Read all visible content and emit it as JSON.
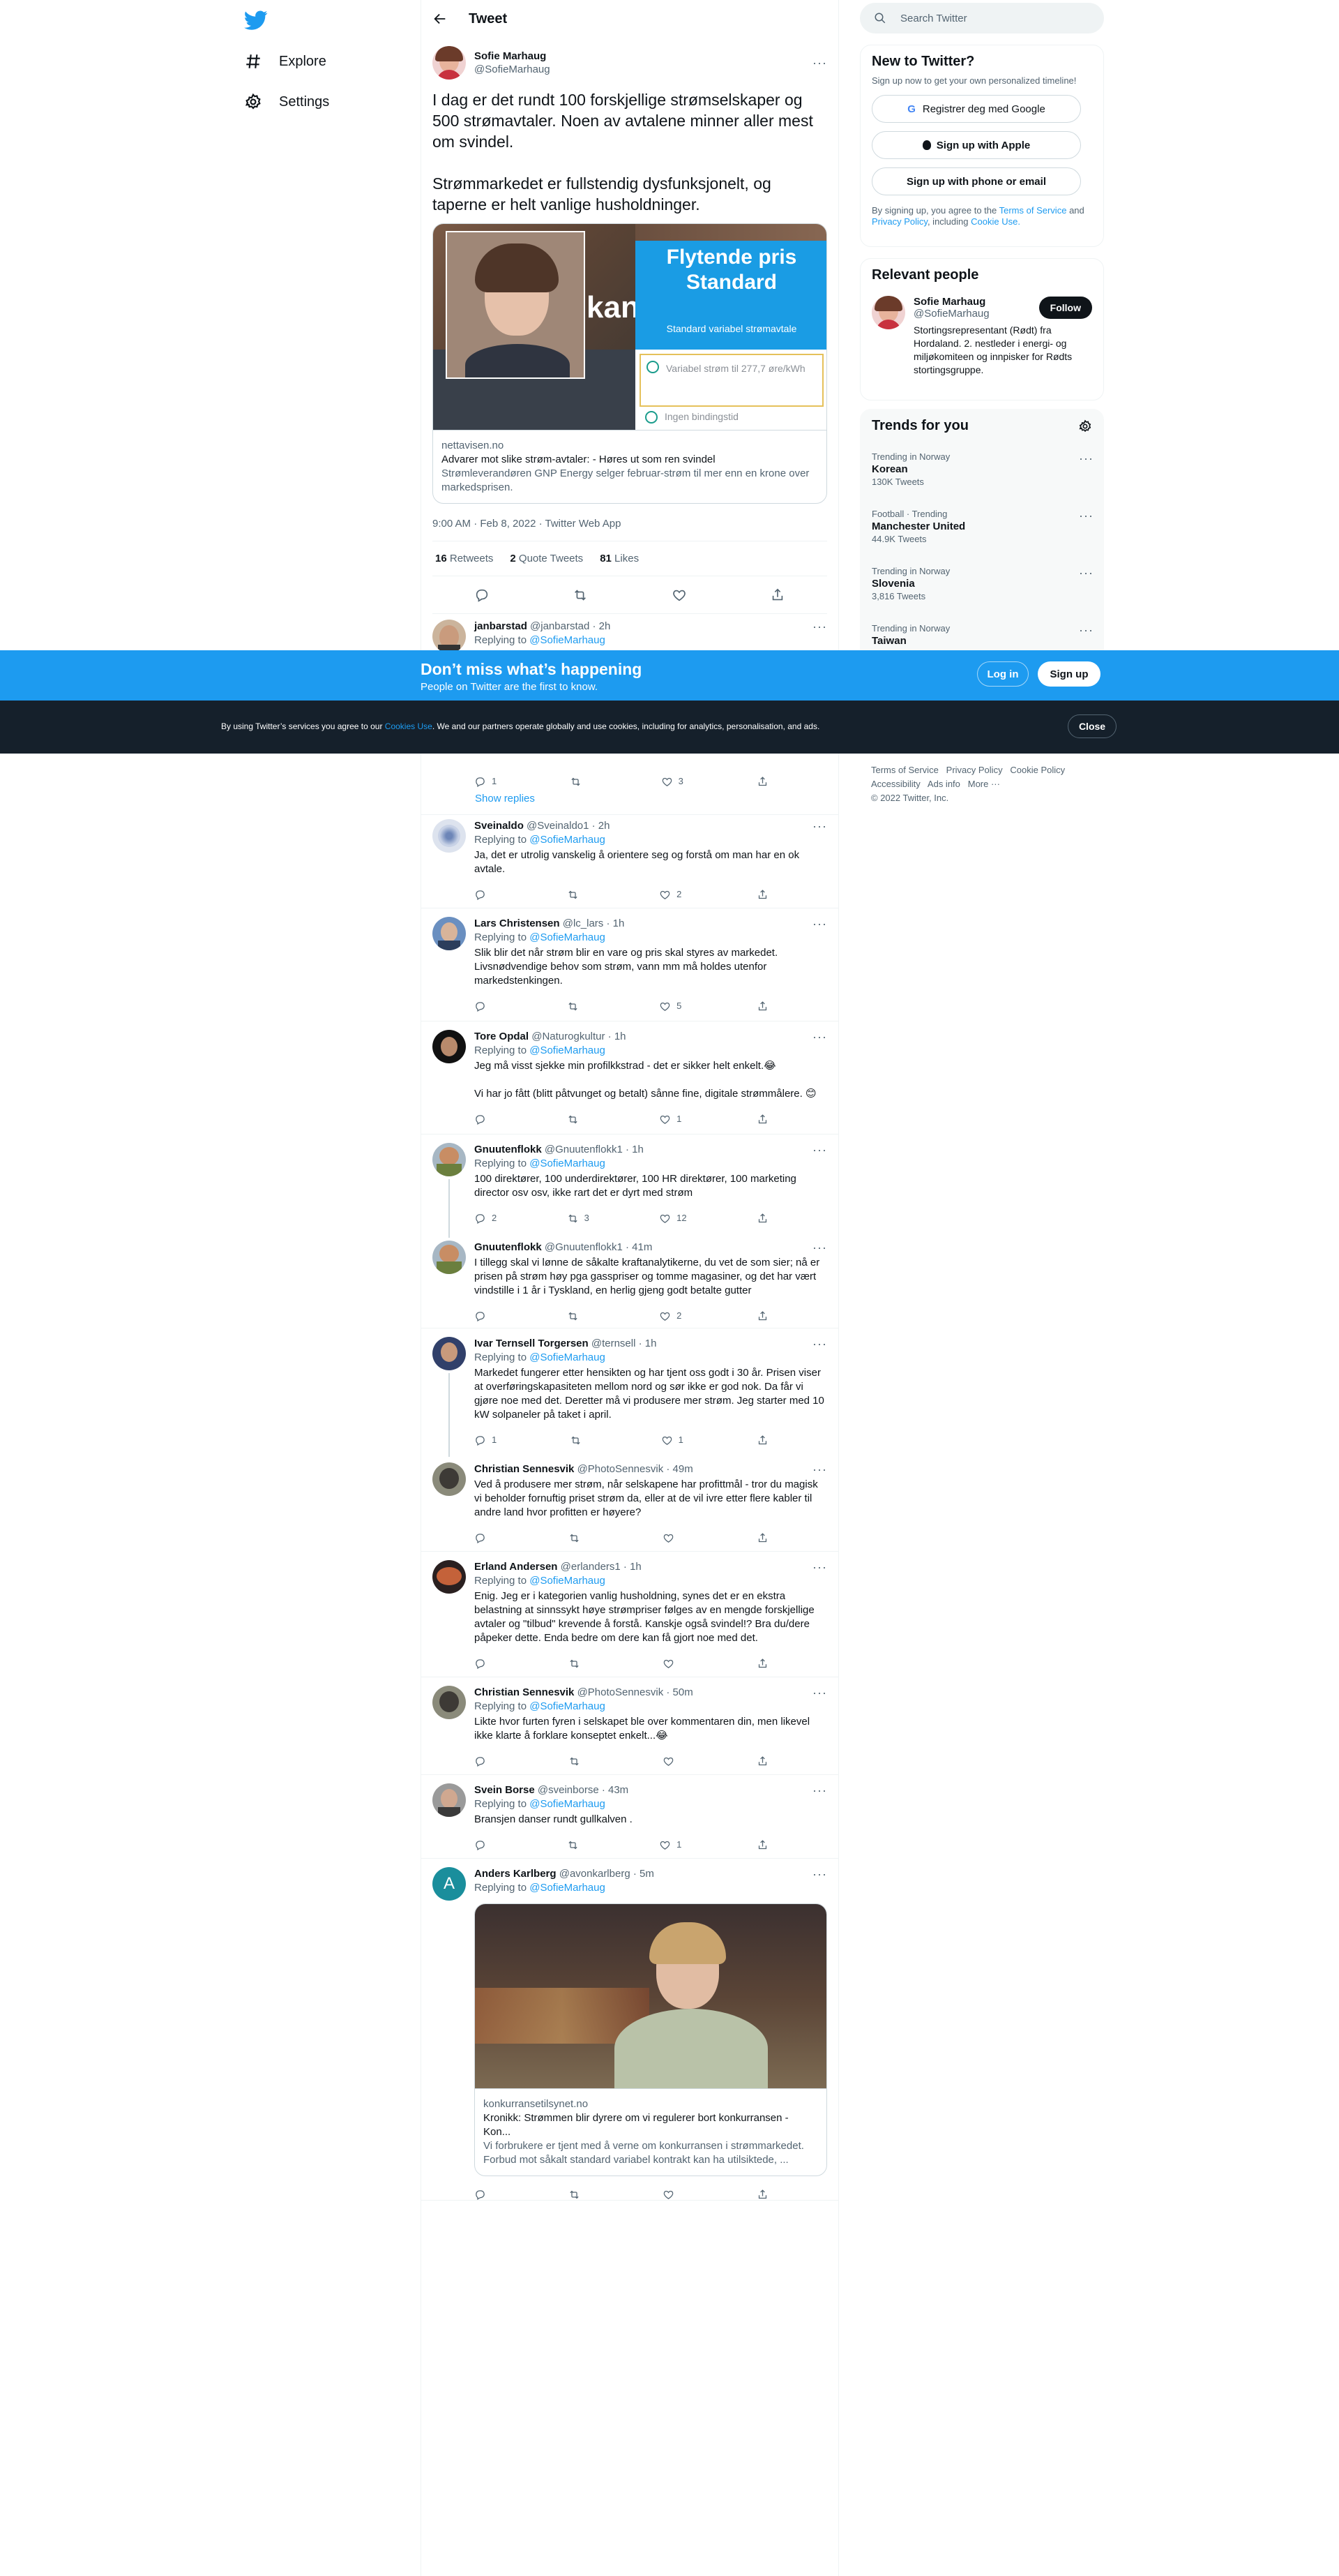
{
  "nav": {
    "explore": "Explore",
    "settings": "Settings"
  },
  "header": {
    "title": "Tweet"
  },
  "main_tweet": {
    "name": "Sofie Marhaug",
    "handle": "@SofieMarhaug",
    "text": "I dag er det rundt 100 forskjellige strømselskaper og 500 strømavtaler. Noen av avtalene minner aller mest om svindel.\n\nStrømmarkedet er fullstendig dysfunksjonelt, og taperne er helt vanlige husholdninger.",
    "card": {
      "img_title": "Flytende pris\nStandard",
      "img_sub": "Standard variabel strømavtale",
      "img_item1": "Variabel strøm til 277,7 øre/kWh",
      "img_item2": "Ingen bindingstid",
      "img_partial": "kan",
      "domain": "nettavisen.no",
      "title": "Advarer mot slike strøm-avtaler: - Høres ut som ren svindel",
      "desc": "Strømleverandøren GNP Energy selger februar-strøm til mer enn en krone over markedsprisen."
    },
    "time": "9:00 AM · Feb 8, 2022 · Twitter Web App",
    "retweets": "16",
    "retweets_label": "Retweets",
    "quotes": "2",
    "quotes_label": "Quote Tweets",
    "likes": "81",
    "likes_label": "Likes"
  },
  "replies": [
    {
      "name": "janbarstad",
      "handle": "@janbarstad · 2h",
      "replying": "Replying to",
      "to": "@SofieMarhaug",
      "text": "",
      "reply": "1",
      "rt": "",
      "like": "3"
    },
    {
      "show_replies": "Show replies"
    },
    {
      "name": "Sveinaldo",
      "handle": "@Sveinaldo1 · 2h",
      "replying": "Replying to",
      "to": "@SofieMarhaug",
      "text": "Ja, det er utrolig vanskelig å orientere seg og forstå om man har en ok avtale.",
      "reply": "",
      "rt": "",
      "like": "2"
    },
    {
      "name": "Lars Christensen",
      "handle": "@lc_lars · 1h",
      "replying": "Replying to",
      "to": "@SofieMarhaug",
      "text": "Slik blir det når strøm blir en vare og pris skal styres av markedet. Livsnødvendige behov som strøm, vann mm må holdes utenfor markedstenkingen.",
      "reply": "",
      "rt": "",
      "like": "5"
    },
    {
      "name": "Tore Opdal",
      "handle": "@Naturogkultur · 1h",
      "replying": "Replying to",
      "to": "@SofieMarhaug",
      "text": "Jeg må visst sjekke min profilkkstrad - det er sikker helt enkelt.😂\n\nVi har jo fått (blitt påtvunget og betalt) sånne fine, digitale strømmålere. 😊",
      "reply": "",
      "rt": "",
      "like": "1"
    },
    {
      "name": "Gnuutenflokk",
      "handle": "@Gnuutenflokk1 · 1h",
      "replying": "Replying to",
      "to": "@SofieMarhaug",
      "text": "100 direktører, 100 underdirektører, 100 HR direktører, 100 marketing director osv osv, ikke rart det er dyrt med strøm",
      "reply": "2",
      "rt": "3",
      "like": "12"
    },
    {
      "name": "Gnuutenflokk",
      "handle": "@Gnuutenflokk1 · 41m",
      "replying": "",
      "to": "",
      "text": "I tillegg skal vi lønne de såkalte kraftanalytikerne, du vet de som sier; nå er prisen på strøm høy pga gasspriser og tomme magasiner, og det har vært vindstille i 1 år i Tyskland, en herlig gjeng godt betalte gutter",
      "reply": "",
      "rt": "",
      "like": "2"
    },
    {
      "name": "Ivar Ternsell Torgersen",
      "handle": "@ternsell · 1h",
      "replying": "Replying to",
      "to": "@SofieMarhaug",
      "text": "Markedet fungerer etter hensikten og har tjent oss godt i 30 år. Prisen viser at overføringskapasiteten mellom nord og sør ikke er god nok. Da får vi gjøre noe med det. Deretter må vi produsere mer strøm. Jeg starter med 10 kW solpaneler på taket i april.",
      "reply": "1",
      "rt": "",
      "like": "1"
    },
    {
      "name": "Christian Sennesvik",
      "handle": "@PhotoSennesvik · 49m",
      "replying": "",
      "to": "",
      "text": "Ved å produsere mer strøm, når selskapene har profittmål - tror du magisk vi beholder fornuftig priset strøm da, eller at de vil ivre etter flere kabler til andre land hvor profitten er høyere?",
      "reply": "",
      "rt": "",
      "like": ""
    },
    {
      "name": "Erland Andersen",
      "handle": "@erlanders1 · 1h",
      "replying": "Replying to",
      "to": "@SofieMarhaug",
      "text": "Enig. Jeg er i kategorien vanlig husholdning, synes det er en ekstra belastning at sinnssykt høye strømpriser følges av en mengde forskjellige avtaler og \"tilbud\" krevende å forstå. Kanskje også svindel!? Bra du/dere påpeker dette. Enda bedre om dere kan få gjort noe med det.",
      "reply": "",
      "rt": "",
      "like": ""
    },
    {
      "name": "Christian Sennesvik",
      "handle": "@PhotoSennesvik · 50m",
      "replying": "Replying to",
      "to": "@SofieMarhaug",
      "text": "Likte hvor furten fyren i selskapet ble over kommentaren din, men likevel ikke klarte å forklare konseptet enkelt...😂",
      "reply": "",
      "rt": "",
      "like": ""
    },
    {
      "name": "Svein Borse",
      "handle": "@sveinborse · 43m",
      "replying": "Replying to",
      "to": "@SofieMarhaug",
      "text": "Bransjen danser rundt gullkalven .",
      "reply": "",
      "rt": "",
      "like": "1"
    },
    {
      "name": "Anders Karlberg",
      "handle": "@avonkarlberg · 5m",
      "replying": "Replying to",
      "to": "@SofieMarhaug",
      "text": "",
      "reply": "",
      "rt": "",
      "like": "",
      "card": {
        "domain": "konkurransetilsynet.no",
        "title": "Kronikk: Strømmen blir dyrere om vi regulerer bort konkurransen - Kon...",
        "desc": "Vi forbrukere er tjent med å verne om konkurransen i strømmarkedet. Forbud mot såkalt standard variabel kontrakt kan ha utilsiktede, ..."
      }
    }
  ],
  "right": {
    "search_placeholder": "Search Twitter",
    "new_title": "New to Twitter?",
    "new_sub": "Sign up now to get your own personalized timeline!",
    "google": "Registrer deg med Google",
    "apple": "Sign up with Apple",
    "phone": "Sign up with phone or email",
    "terms_a": "By signing up, you agree to the",
    "terms_tos": "Terms of Service",
    "terms_and": "and",
    "terms_pp": "Privacy Policy",
    "terms_incl": ", including",
    "terms_cookie": "Cookie Use.",
    "relevant_title": "Relevant people",
    "rp_name": "Sofie Marhaug",
    "rp_handle": "@SofieMarhaug",
    "rp_follow": "Follow",
    "rp_bio": "Stortingsrepresentant (Rødt) fra Hordaland. 2. nestleder i energi- og miljøkomiteen og innpisker for Rødts stortingsgruppe.",
    "trends_title": "Trends for you",
    "trends": [
      {
        "cat": "Trending in Norway",
        "name": "Korean",
        "count": "130K Tweets"
      },
      {
        "cat": "Football · Trending",
        "name": "Manchester United",
        "count": "44.9K Tweets"
      },
      {
        "cat": "Trending in Norway",
        "name": "Slovenia",
        "count": "3,816 Tweets"
      },
      {
        "cat": "Trending in Norway",
        "name": "Taiwan",
        "count": ""
      }
    ],
    "footer": [
      "Terms of Service",
      "Privacy Policy",
      "Cookie Policy",
      "Accessibility",
      "Ads info",
      "More ···",
      "© 2022 Twitter, Inc."
    ]
  },
  "banner": {
    "title": "Don’t miss what’s happening",
    "sub": "People on Twitter are the first to know.",
    "login": "Log in",
    "signup": "Sign up"
  },
  "cookie": {
    "text_a": "By using Twitter’s services you agree to our",
    "link": "Cookies Use",
    "text_b": ". We and our partners operate globally and use cookies, including for analytics, personalisation, and ads.",
    "close": "Close"
  },
  "colors": {
    "accent": "#1d9bf0",
    "banner_bg": "#1d9bf0",
    "cookie_bg": "#15202b"
  }
}
